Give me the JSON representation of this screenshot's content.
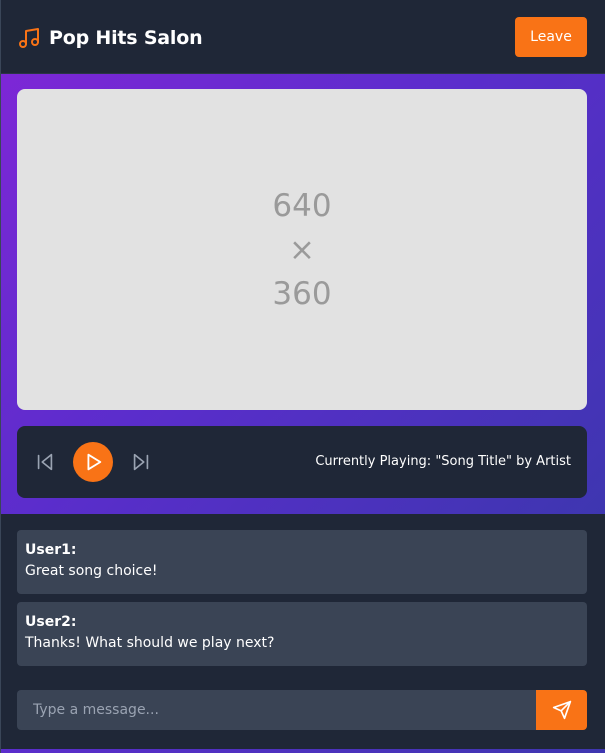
{
  "header": {
    "title": "Pop Hits Salon",
    "leave_label": "Leave",
    "icon": "music-note-icon"
  },
  "video": {
    "placeholder_width": "640",
    "placeholder_times": "×",
    "placeholder_height": "360"
  },
  "player": {
    "now_playing": "Currently Playing: \"Song Title\" by Artist",
    "prev_icon": "skip-back-icon",
    "play_icon": "play-icon",
    "next_icon": "skip-forward-icon"
  },
  "chat": {
    "messages": [
      {
        "user": "User1:",
        "text": "Great song choice!"
      },
      {
        "user": "User2:",
        "text": "Thanks! What should we play next?"
      }
    ],
    "input_placeholder": "Type a message...",
    "send_icon": "send-icon"
  },
  "colors": {
    "accent": "#f97316",
    "background": "#1f2737",
    "message_bg": "#3a4455",
    "gradient_start": "#7d27d6",
    "gradient_end": "#3e36b0"
  }
}
